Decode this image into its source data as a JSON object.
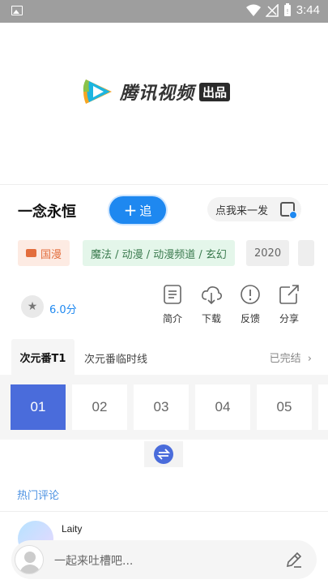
{
  "status_bar": {
    "time": "3:44"
  },
  "player": {
    "logo_text": "腾讯视频",
    "logo_badge": "出品"
  },
  "show": {
    "title": "一念永恒",
    "follow_label": "追",
    "comment_prompt": "点我来一发"
  },
  "tags": {
    "category": "国漫",
    "genres": "魔法 / 动漫 / 动漫频道 / 玄幻",
    "year": "2020"
  },
  "rating": {
    "score": "6.0分"
  },
  "actions": [
    {
      "label": "简介",
      "icon": "intro-icon"
    },
    {
      "label": "下载",
      "icon": "download-icon"
    },
    {
      "label": "反馈",
      "icon": "feedback-icon"
    },
    {
      "label": "分享",
      "icon": "share-icon"
    }
  ],
  "tabs": {
    "active": "次元番T1",
    "other": "次元番临时线",
    "status": "已完结"
  },
  "episodes": [
    "01",
    "02",
    "03",
    "04",
    "05"
  ],
  "comments": {
    "section_title": "热门评论",
    "first_user": "Laity"
  },
  "input": {
    "placeholder": "一起来吐槽吧..."
  },
  "colors": {
    "accent": "#1e88f0",
    "episode_active": "#4a6cdb"
  }
}
